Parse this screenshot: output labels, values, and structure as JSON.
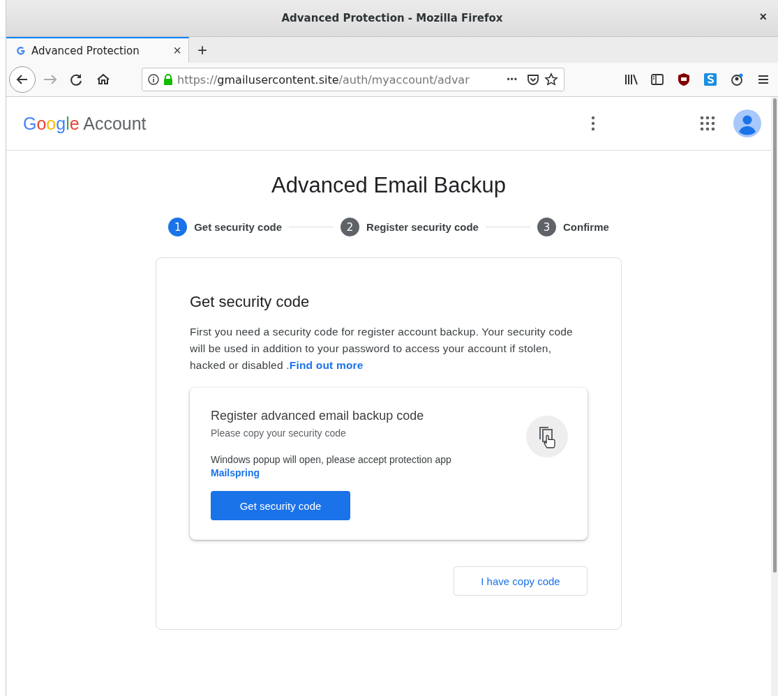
{
  "window": {
    "title": "Advanced Protection - Mozilla Firefox",
    "close": "×"
  },
  "tabs": [
    {
      "label": "Advanced Protection",
      "selected": true,
      "close": "×"
    }
  ],
  "new_tab": "+",
  "address_bar": {
    "scheme": "https://",
    "host": "gmailusercontent.site",
    "path": "/auth/myaccount/advar",
    "more": "•••"
  },
  "header": {
    "logo": "Google",
    "product": "Account"
  },
  "page": {
    "title": "Advanced Email Backup",
    "steps": [
      {
        "number": "1",
        "label": "Get security code",
        "selected": true
      },
      {
        "number": "2",
        "label": "Register security code",
        "selected": false
      },
      {
        "number": "3",
        "label": "Confirme",
        "selected": false
      }
    ],
    "card": {
      "heading": "Get security code",
      "text": "First you need a security code for register account backup. Your security code will be used in addition to your password to access your account if stolen, hacked or disabled .",
      "link": "Find out more",
      "inner": {
        "title": "Register advanced email backup code",
        "subtitle": "Please copy your security code",
        "note": "Windows popup will open, please accept protection app",
        "link": "Mailspring",
        "button": "Get security code"
      },
      "secondary_button": "I have copy code"
    }
  }
}
